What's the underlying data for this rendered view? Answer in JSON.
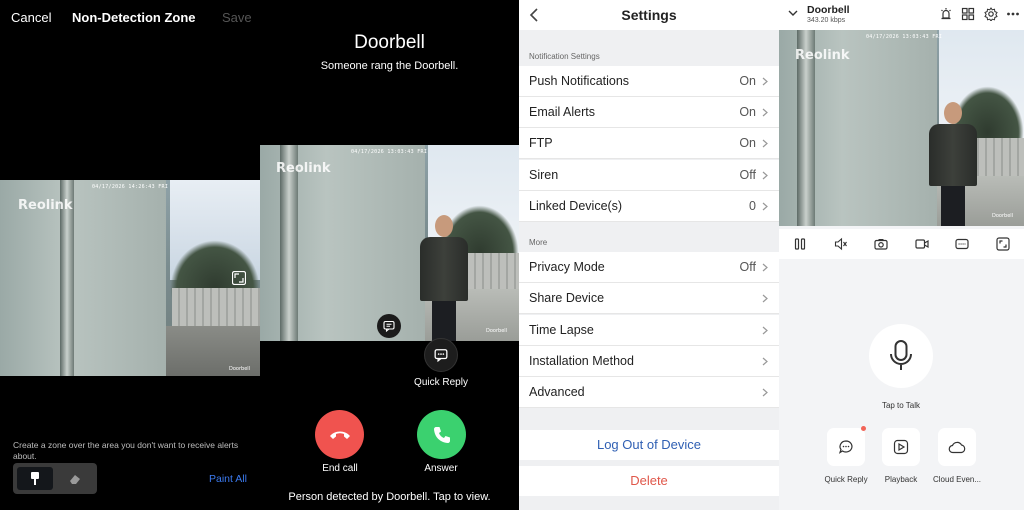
{
  "zone_editor": {
    "cancel_label": "Cancel",
    "title": "Non-Detection Zone",
    "save_label": "Save",
    "camera_timestamp": "04/17/2026 14:26:43 FRI",
    "camera_logo": "Reolink",
    "camera_name": "Doorbell",
    "hint": "Create a zone over the area you don't want to receive alerts about.",
    "tools": [
      {
        "icon": "paint-brush-icon",
        "active": true
      },
      {
        "icon": "eraser-icon",
        "active": false
      }
    ],
    "paint_all_label": "Paint All"
  },
  "incoming_call": {
    "title": "Doorbell",
    "subtitle": "Someone rang the Doorbell.",
    "camera_timestamp": "04/17/2026 13:03:43 FRI",
    "camera_logo": "Reolink",
    "camera_name": "Doorbell",
    "quick_reply_label": "Quick Reply",
    "end_call_label": "End call",
    "answer_label": "Answer",
    "banner": "Person detected by Doorbell. Tap to view."
  },
  "settings": {
    "title": "Settings",
    "notification_section": "Notification Settings",
    "notification_rows": [
      {
        "label": "Push Notifications",
        "value": "On"
      },
      {
        "label": "Email Alerts",
        "value": "On"
      },
      {
        "label": "FTP",
        "value": "On"
      },
      {
        "label": "Siren",
        "value": "Off"
      },
      {
        "label": "Linked Device(s)",
        "value": "0"
      }
    ],
    "more_section": "More",
    "more_rows": [
      {
        "label": "Privacy Mode",
        "value": "Off"
      },
      {
        "label": "Share Device",
        "value": ""
      },
      {
        "label": "Time Lapse",
        "value": ""
      },
      {
        "label": "Installation Method",
        "value": ""
      },
      {
        "label": "Advanced",
        "value": ""
      }
    ],
    "logout_label": "Log Out of Device",
    "delete_label": "Delete",
    "colors": {
      "link": "#2f5fb3",
      "danger": "#e0574a"
    }
  },
  "live_view": {
    "device_name": "Doorbell",
    "bitrate": "343.20 kbps",
    "top_icons": [
      "alarm-bell-icon",
      "grid-icon",
      "settings-gear-icon",
      "more-dots-icon"
    ],
    "camera_timestamp": "04/17/2026 13:03:43 FRI",
    "camera_logo": "Reolink",
    "camera_name": "Doorbell",
    "controls": [
      "pause-icon",
      "volume-icon",
      "snapshot-icon",
      "record-video-icon",
      "quality-icon",
      "fullscreen-icon"
    ],
    "tap_to_talk_label": "Tap to Talk",
    "actions": [
      {
        "label": "Quick Reply",
        "icon": "chat-bubble-icon",
        "badge": true
      },
      {
        "label": "Playback",
        "icon": "playback-icon",
        "badge": false
      },
      {
        "label": "Cloud Even...",
        "icon": "cloud-icon",
        "badge": false
      }
    ]
  }
}
